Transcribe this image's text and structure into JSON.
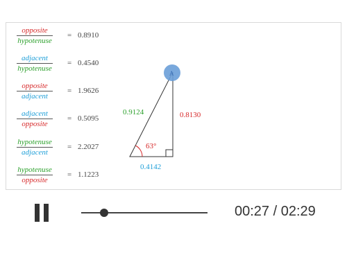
{
  "colors": {
    "opposite": "#d62728",
    "adjacent": "#1f9fd8",
    "hypotenuse": "#2ca02c",
    "handle": "#6a9fd8",
    "text": "#444444"
  },
  "ratios": [
    {
      "num": "opposite",
      "den": "hypotenuse",
      "value": "0.8910"
    },
    {
      "num": "adjacent",
      "den": "hypotenuse",
      "value": "0.4540"
    },
    {
      "num": "opposite",
      "den": "adjacent",
      "value": "1.9626"
    },
    {
      "num": "adjacent",
      "den": "opposite",
      "value": "0.5095"
    },
    {
      "num": "hypotenuse",
      "den": "adjacent",
      "value": "2.2027"
    },
    {
      "num": "hypotenuse",
      "den": "opposite",
      "value": "1.1223"
    }
  ],
  "triangle": {
    "hypotenuse_length": "0.9124",
    "opposite_length": "0.8130",
    "adjacent_length": "0.4142",
    "angle_label": "63°"
  },
  "player": {
    "current_time": "00:27",
    "duration": "02:29",
    "time_separator": " / ",
    "progress": 0.181
  }
}
